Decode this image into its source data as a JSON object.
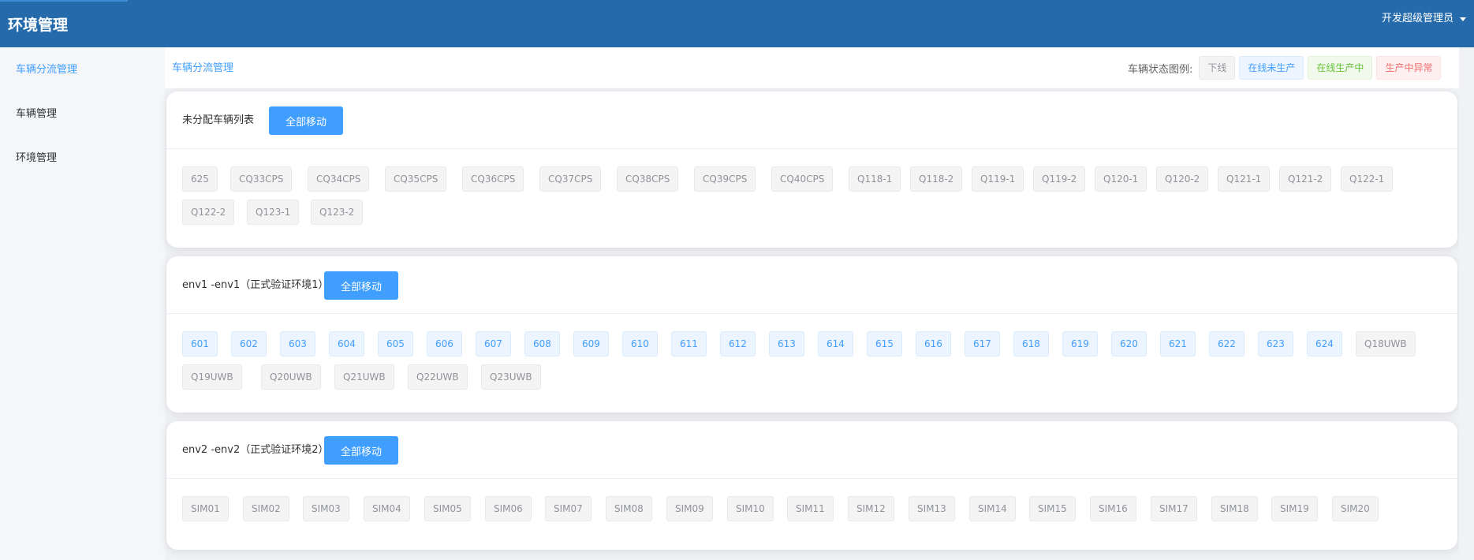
{
  "header": {
    "title": "环境管理",
    "user": "开发超级管理员"
  },
  "sidebar": {
    "items": [
      {
        "label": "车辆分流管理",
        "active": true
      },
      {
        "label": "车辆管理",
        "active": false
      },
      {
        "label": "环境管理",
        "active": false
      }
    ]
  },
  "breadcrumb": "车辆分流管理",
  "legend": {
    "label": "车辆状态图例:",
    "items": [
      {
        "label": "下线",
        "status": "offline"
      },
      {
        "label": "在线未生产",
        "status": "idle"
      },
      {
        "label": "在线生产中",
        "status": "prod"
      },
      {
        "label": "生产中异常",
        "status": "error"
      }
    ]
  },
  "move_all_label": "全部移动",
  "colors": {
    "header_bg": "#256bab",
    "accent": "#409eff",
    "offline": "#909399",
    "idle": "#409eff",
    "prod": "#67c23a",
    "error": "#f56c6c"
  },
  "sections": [
    {
      "title": "未分配车辆列表",
      "vehicles": [
        {
          "name": "625",
          "status": "offline"
        },
        {
          "name": "CQ33CPS",
          "status": "offline"
        },
        {
          "name": "CQ34CPS",
          "status": "offline"
        },
        {
          "name": "CQ35CPS",
          "status": "offline"
        },
        {
          "name": "CQ36CPS",
          "status": "offline"
        },
        {
          "name": "CQ37CPS",
          "status": "offline"
        },
        {
          "name": "CQ38CPS",
          "status": "offline"
        },
        {
          "name": "CQ39CPS",
          "status": "offline"
        },
        {
          "name": "CQ40CPS",
          "status": "offline"
        },
        {
          "name": "Q118-1",
          "status": "offline"
        },
        {
          "name": "Q118-2",
          "status": "offline"
        },
        {
          "name": "Q119-1",
          "status": "offline"
        },
        {
          "name": "Q119-2",
          "status": "offline"
        },
        {
          "name": "Q120-1",
          "status": "offline"
        },
        {
          "name": "Q120-2",
          "status": "offline"
        },
        {
          "name": "Q121-1",
          "status": "offline"
        },
        {
          "name": "Q121-2",
          "status": "offline"
        },
        {
          "name": "Q122-1",
          "status": "offline"
        },
        {
          "name": "Q122-2",
          "status": "offline"
        },
        {
          "name": "Q123-1",
          "status": "offline"
        },
        {
          "name": "Q123-2",
          "status": "offline"
        }
      ]
    },
    {
      "title": "env1 -env1（正式验证环境1）",
      "vehicles": [
        {
          "name": "601",
          "status": "idle"
        },
        {
          "name": "602",
          "status": "idle"
        },
        {
          "name": "603",
          "status": "idle"
        },
        {
          "name": "604",
          "status": "idle"
        },
        {
          "name": "605",
          "status": "idle"
        },
        {
          "name": "606",
          "status": "idle"
        },
        {
          "name": "607",
          "status": "idle"
        },
        {
          "name": "608",
          "status": "idle"
        },
        {
          "name": "609",
          "status": "idle"
        },
        {
          "name": "610",
          "status": "idle"
        },
        {
          "name": "611",
          "status": "idle"
        },
        {
          "name": "612",
          "status": "idle"
        },
        {
          "name": "613",
          "status": "idle"
        },
        {
          "name": "614",
          "status": "idle"
        },
        {
          "name": "615",
          "status": "idle"
        },
        {
          "name": "616",
          "status": "idle"
        },
        {
          "name": "617",
          "status": "idle"
        },
        {
          "name": "618",
          "status": "idle"
        },
        {
          "name": "619",
          "status": "idle"
        },
        {
          "name": "620",
          "status": "idle"
        },
        {
          "name": "621",
          "status": "idle"
        },
        {
          "name": "622",
          "status": "idle"
        },
        {
          "name": "623",
          "status": "idle"
        },
        {
          "name": "624",
          "status": "idle"
        },
        {
          "name": "Q18UWB",
          "status": "offline"
        },
        {
          "name": "Q19UWB",
          "status": "offline"
        },
        {
          "name": "Q20UWB",
          "status": "offline"
        },
        {
          "name": "Q21UWB",
          "status": "offline"
        },
        {
          "name": "Q22UWB",
          "status": "offline"
        },
        {
          "name": "Q23UWB",
          "status": "offline"
        }
      ]
    },
    {
      "title": "env2 -env2（正式验证环境2）",
      "vehicles": [
        {
          "name": "SIM01",
          "status": "offline"
        },
        {
          "name": "SIM02",
          "status": "offline"
        },
        {
          "name": "SIM03",
          "status": "offline"
        },
        {
          "name": "SIM04",
          "status": "offline"
        },
        {
          "name": "SIM05",
          "status": "offline"
        },
        {
          "name": "SIM06",
          "status": "offline"
        },
        {
          "name": "SIM07",
          "status": "offline"
        },
        {
          "name": "SIM08",
          "status": "offline"
        },
        {
          "name": "SIM09",
          "status": "offline"
        },
        {
          "name": "SIM10",
          "status": "offline"
        },
        {
          "name": "SIM11",
          "status": "offline"
        },
        {
          "name": "SIM12",
          "status": "offline"
        },
        {
          "name": "SIM13",
          "status": "offline"
        },
        {
          "name": "SIM14",
          "status": "offline"
        },
        {
          "name": "SIM15",
          "status": "offline"
        },
        {
          "name": "SIM16",
          "status": "offline"
        },
        {
          "name": "SIM17",
          "status": "offline"
        },
        {
          "name": "SIM18",
          "status": "offline"
        },
        {
          "name": "SIM19",
          "status": "offline"
        },
        {
          "name": "SIM20",
          "status": "offline"
        }
      ]
    }
  ]
}
